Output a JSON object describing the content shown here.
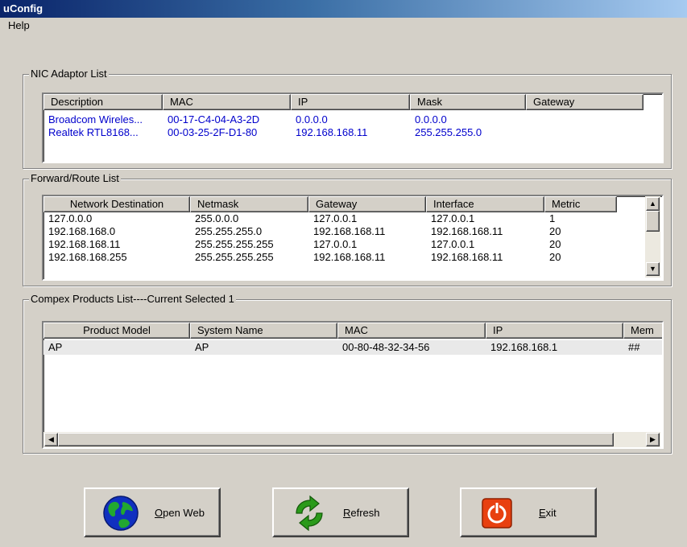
{
  "window": {
    "title": "uConfig"
  },
  "menu": {
    "help_label": "Help"
  },
  "nic": {
    "legend": "NIC Adaptor List",
    "columns": [
      "Description",
      "MAC",
      "IP",
      "Mask",
      "Gateway"
    ],
    "rows": [
      [
        "Broadcom Wireles...",
        "00-17-C4-04-A3-2D",
        "0.0.0.0",
        "0.0.0.0",
        ""
      ],
      [
        "Realtek RTL8168...",
        "00-03-25-2F-D1-80",
        "192.168.168.11",
        "255.255.255.0",
        ""
      ]
    ]
  },
  "route": {
    "legend": "Forward/Route List",
    "columns": [
      "Network Destination",
      "Netmask",
      "Gateway",
      "Interface",
      "Metric"
    ],
    "rows": [
      [
        "127.0.0.0",
        "255.0.0.0",
        "127.0.0.1",
        "127.0.0.1",
        "1"
      ],
      [
        "192.168.168.0",
        "255.255.255.0",
        "192.168.168.11",
        "192.168.168.11",
        "20"
      ],
      [
        "192.168.168.11",
        "255.255.255.255",
        "127.0.0.1",
        "127.0.0.1",
        "20"
      ],
      [
        "192.168.168.255",
        "255.255.255.255",
        "192.168.168.11",
        "192.168.168.11",
        "20"
      ]
    ]
  },
  "products": {
    "legend": "Compex Products List----Current Selected 1",
    "columns": [
      "Product Model",
      "System Name",
      "MAC",
      "IP",
      "Mem"
    ],
    "rows": [
      [
        "AP",
        "AP",
        "00-80-48-32-34-56",
        "192.168.168.1",
        "##"
      ]
    ]
  },
  "buttons": {
    "open_web": "Open Web",
    "refresh": "Refresh",
    "exit": "Exit"
  },
  "icons": {
    "open_web": "globe-icon",
    "refresh": "refresh-arrows-icon",
    "exit": "power-icon"
  }
}
